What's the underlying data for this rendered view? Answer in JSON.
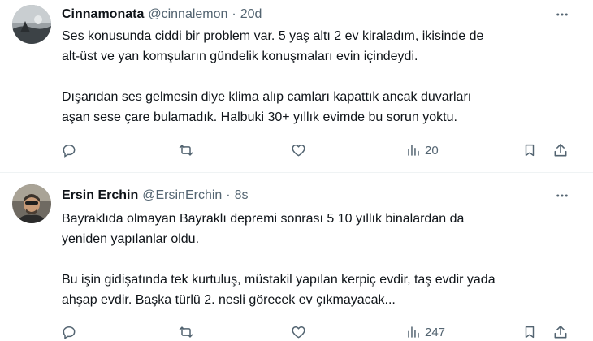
{
  "tweets": [
    {
      "name": "Cinnamonata",
      "handle": "@cinnalemon",
      "separator": "·",
      "time": "20d",
      "lines": [
        "Ses konusunda ciddi bir problem var. 5 yaş altı 2 ev kiraladım, ikisinde de",
        "alt-üst ve yan komşuların gündelik konuşmaları evin içindeydi.",
        "Dışarıdan ses gelmesin diye klima alıp camları kapattık ancak duvarları",
        "aşan sese çare bulamadık. Halbuki 30+ yıllık evimde bu sorun yoktu."
      ],
      "views": "20",
      "avatar_icon": "avatar-photo"
    },
    {
      "name": "Ersin Erchin",
      "handle": "@ErsinErchin",
      "separator": "·",
      "time": "8s",
      "lines": [
        "Bayraklıda olmayan Bayraklı depremi sonrası 5 10 yıllık binalardan da",
        "yeniden yapılanlar oldu.",
        "Bu işin gidişatında tek kurtuluş, müstakil yapılan kerpiç evdir, taş evdir yada",
        "ahşap evdir. Başka türlü 2. nesli görecek ev çıkmayacak..."
      ],
      "views": "247",
      "avatar_icon": "avatar-photo"
    }
  ],
  "icons": [
    "more-icon",
    "reply-icon",
    "retweet-icon",
    "like-icon",
    "views-icon",
    "bookmark-icon",
    "share-icon"
  ],
  "colors": {
    "text": "#0f1419",
    "secondary": "#536471",
    "divider": "#eff3f4",
    "background": "#ffffff"
  }
}
